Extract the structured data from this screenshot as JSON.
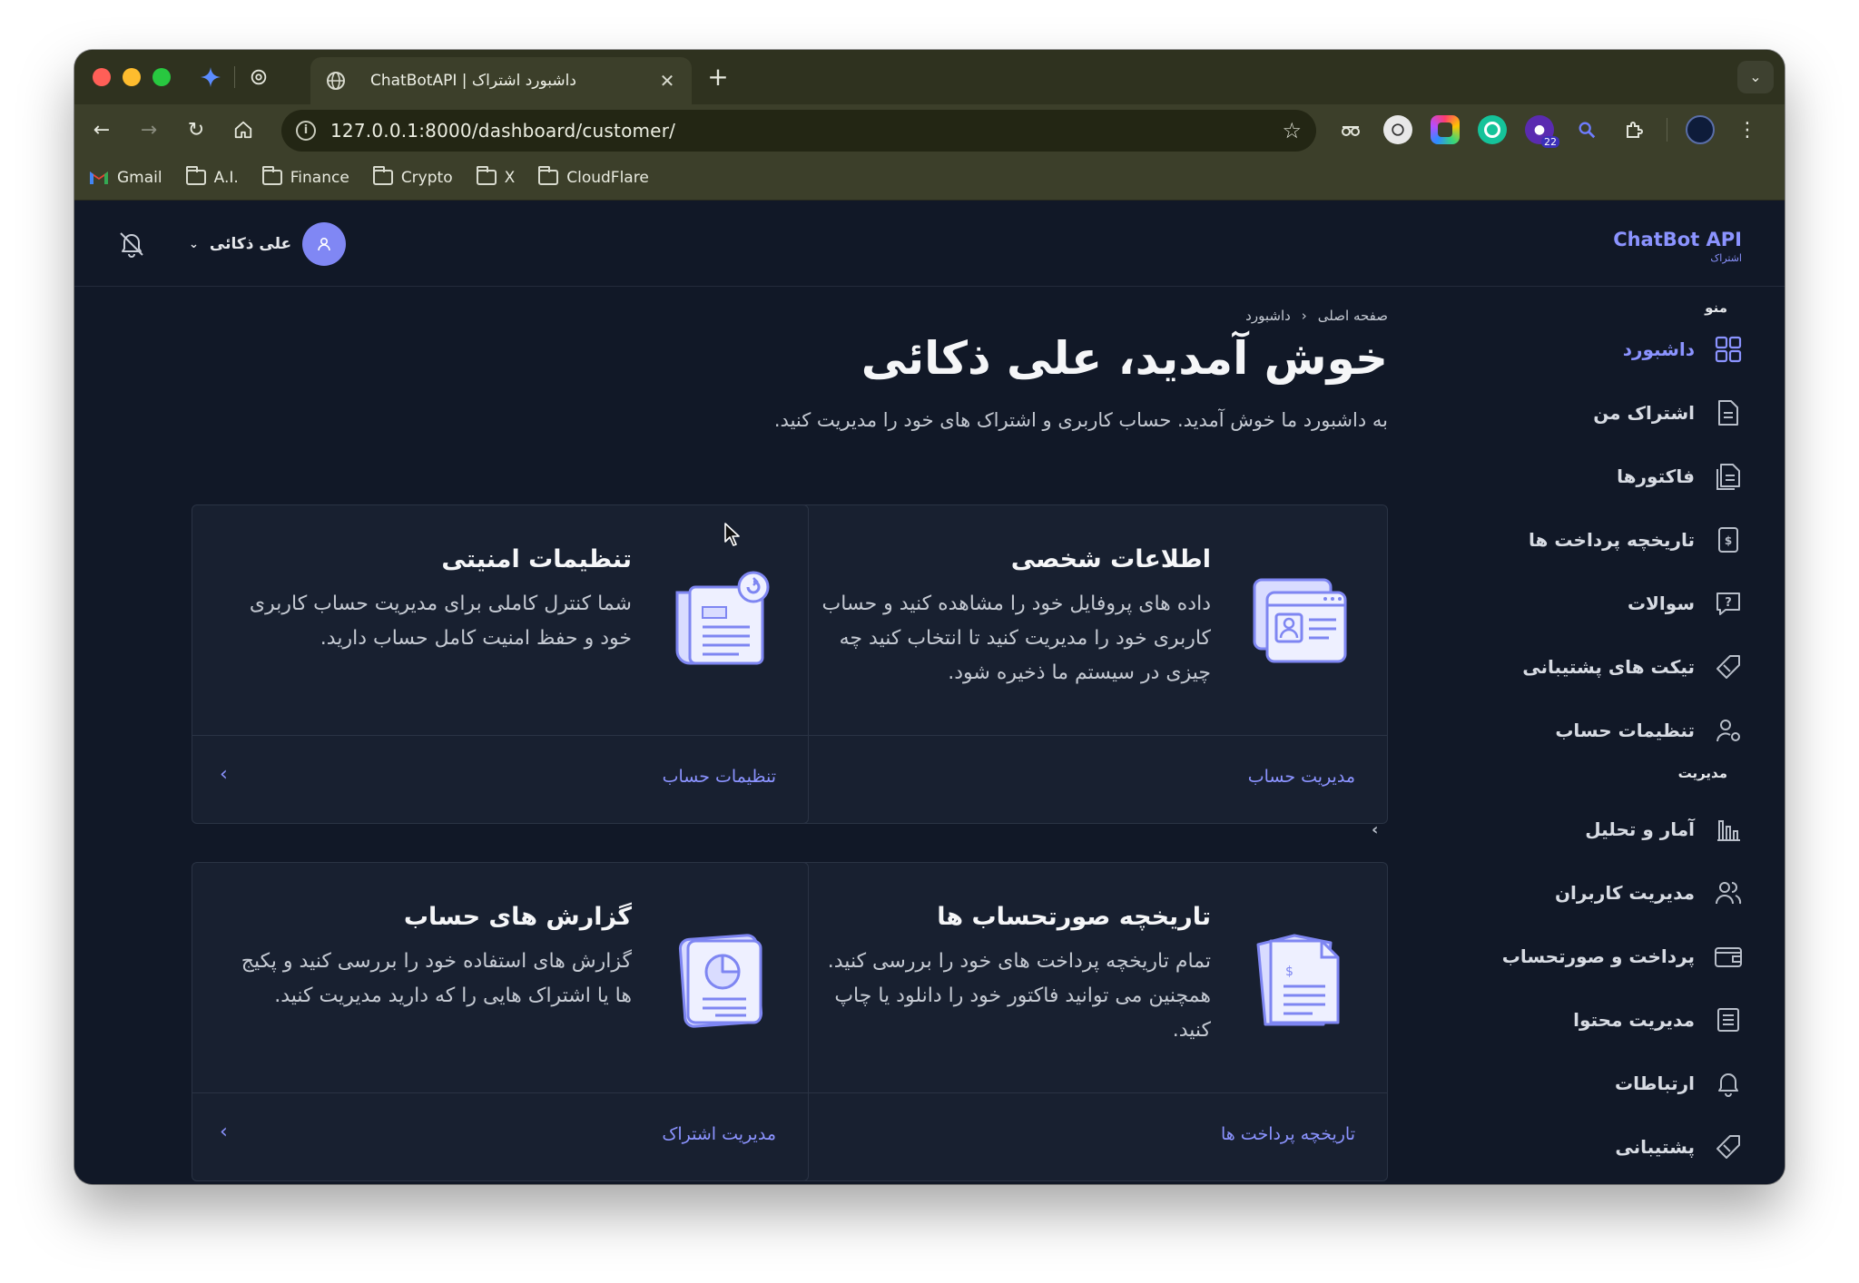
{
  "browser": {
    "tab_title": "ChatBotAPI | داشبورد اشتراک",
    "url": "127.0.0.1:8000/dashboard/customer/",
    "extension_badge": "22",
    "bookmarks": [
      {
        "label": "Gmail",
        "icon": "gmail-icon"
      },
      {
        "label": "A.I.",
        "icon": "folder-icon"
      },
      {
        "label": "Finance",
        "icon": "folder-icon"
      },
      {
        "label": "Crypto",
        "icon": "folder-icon"
      },
      {
        "label": "X",
        "icon": "folder-icon"
      },
      {
        "label": "CloudFlare",
        "icon": "folder-icon"
      }
    ]
  },
  "header": {
    "brand_title": "ChatBot API",
    "brand_subtitle": "اشتراک",
    "user_name": "علی ذکائی"
  },
  "sidebar": {
    "menu_heading": "منو",
    "manage_heading": "مدیریت",
    "menu_items": [
      {
        "label": "داشبورد",
        "icon": "grid-icon",
        "active": true
      },
      {
        "label": "اشتراک من",
        "icon": "document-icon"
      },
      {
        "label": "فاکتورها",
        "icon": "invoices-icon"
      },
      {
        "label": "تاریخچه پرداخت ها",
        "icon": "receipt-icon"
      },
      {
        "label": "سوالات",
        "icon": "question-icon"
      },
      {
        "label": "تیکت های پشتیبانی",
        "icon": "ticket-icon"
      },
      {
        "label": "تنظیمات حساب",
        "icon": "user-gear-icon"
      }
    ],
    "manage_items": [
      {
        "label": "آمار و تحلیل",
        "icon": "bar-chart-icon"
      },
      {
        "label": "مدیریت کاربران",
        "icon": "users-icon"
      },
      {
        "label": "پرداخت و صورتحساب",
        "icon": "wallet-icon"
      },
      {
        "label": "مدیریت محتوا",
        "icon": "content-icon"
      },
      {
        "label": "ارتباطات",
        "icon": "bell-icon"
      },
      {
        "label": "پشتیبانی",
        "icon": "ticket-icon"
      }
    ]
  },
  "main": {
    "breadcrumb_home": "صفحه اصلی",
    "breadcrumb_current": "داشبورد",
    "welcome": "خوش آمدید، علی ذکائی",
    "lead": "به داشبورد ما خوش آمدید. حساب کاربری و اشتراک های خود را مدیریت کنید.",
    "cards": [
      {
        "title": "اطلاعات شخصی",
        "desc": "داده های پروفایل خود را مشاهده کنید و حساب کاربری خود را مدیریت کنید تا انتخاب کنید چه چیزی در سیستم ما ذخیره شود.",
        "link": "مدیریت حساب",
        "icon": "profile-card-icon"
      },
      {
        "title": "تنظیمات امنیتی",
        "desc": "شما کنترل کاملی برای مدیریت حساب کاربری خود و حفظ امنیت کامل حساب دارید.",
        "link": "تنظیمات حساب",
        "icon": "security-doc-icon"
      },
      {
        "title": "تاریخچه صورتحساب ها",
        "desc": "تمام تاریخچه پرداخت های خود را بررسی کنید. همچنین می توانید فاکتور خود را دانلود یا چاپ کنید.",
        "link": "تاریخچه پرداخت ها",
        "icon": "billing-doc-icon"
      },
      {
        "title": "گزارش های حساب",
        "desc": "گزارش های استفاده خود را بررسی کنید و پکیج ها یا اشتراک هایی را که دارید مدیریت کنید.",
        "link": "مدیریت اشتراک",
        "icon": "report-doc-icon"
      }
    ]
  },
  "colors": {
    "accent": "#8b93ff",
    "page_bg": "#111827",
    "card_bg": "#182030",
    "browser_chrome": "#3c3f2a"
  }
}
